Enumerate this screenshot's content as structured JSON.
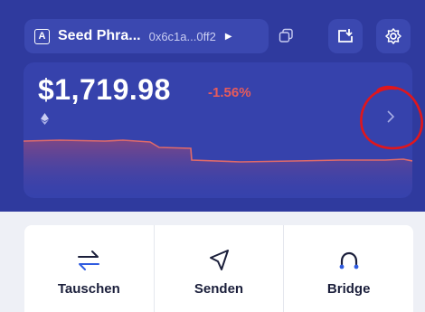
{
  "account": {
    "badge": "A",
    "name": "Seed Phra...",
    "address": "0x6c1a...0ff2"
  },
  "balance": {
    "value": "$1,719.98",
    "change": "-1.56%"
  },
  "actions": [
    {
      "label": "Tauschen",
      "icon": "swap-arrows-icon"
    },
    {
      "label": "Senden",
      "icon": "send-arrow-icon"
    },
    {
      "label": "Bridge",
      "icon": "bridge-icon"
    }
  ],
  "colors": {
    "header": "#2f3a9e",
    "card": "#3642ac",
    "negative": "#e85b5b",
    "annotation": "#e0161c"
  }
}
